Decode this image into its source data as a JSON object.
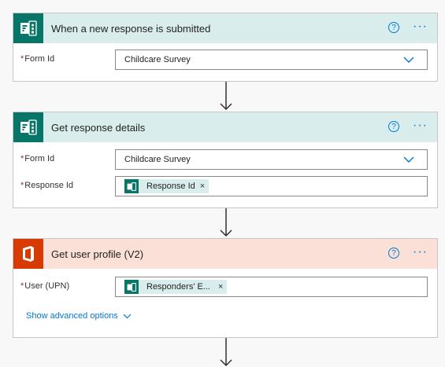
{
  "cards": [
    {
      "title": "When a new response is submitted",
      "icon": "forms-icon",
      "fields": [
        {
          "label": "Form Id",
          "required": "*",
          "value": "Childcare Survey",
          "type": "dropdown"
        }
      ]
    },
    {
      "title": "Get response details",
      "icon": "forms-icon",
      "fields": [
        {
          "label": "Form Id",
          "required": "*",
          "value": "Childcare Survey",
          "type": "dropdown"
        },
        {
          "label": "Response Id",
          "required": "*",
          "token": "Response Id",
          "type": "token"
        }
      ]
    },
    {
      "title": "Get user profile (V2)",
      "icon": "office-icon",
      "fields": [
        {
          "label": "User (UPN)",
          "required": "*",
          "token": "Responders' E...",
          "type": "token"
        }
      ],
      "advanced_link": "Show advanced options"
    }
  ],
  "help_symbol": "?",
  "more_symbol": "···",
  "token_close_symbol": "×",
  "colors": {
    "teal_header": "#d9eeec",
    "teal_icon": "#077568",
    "orange_header": "#fbe0d8",
    "orange_icon": "#d83b01",
    "accent": "#0078d4"
  }
}
